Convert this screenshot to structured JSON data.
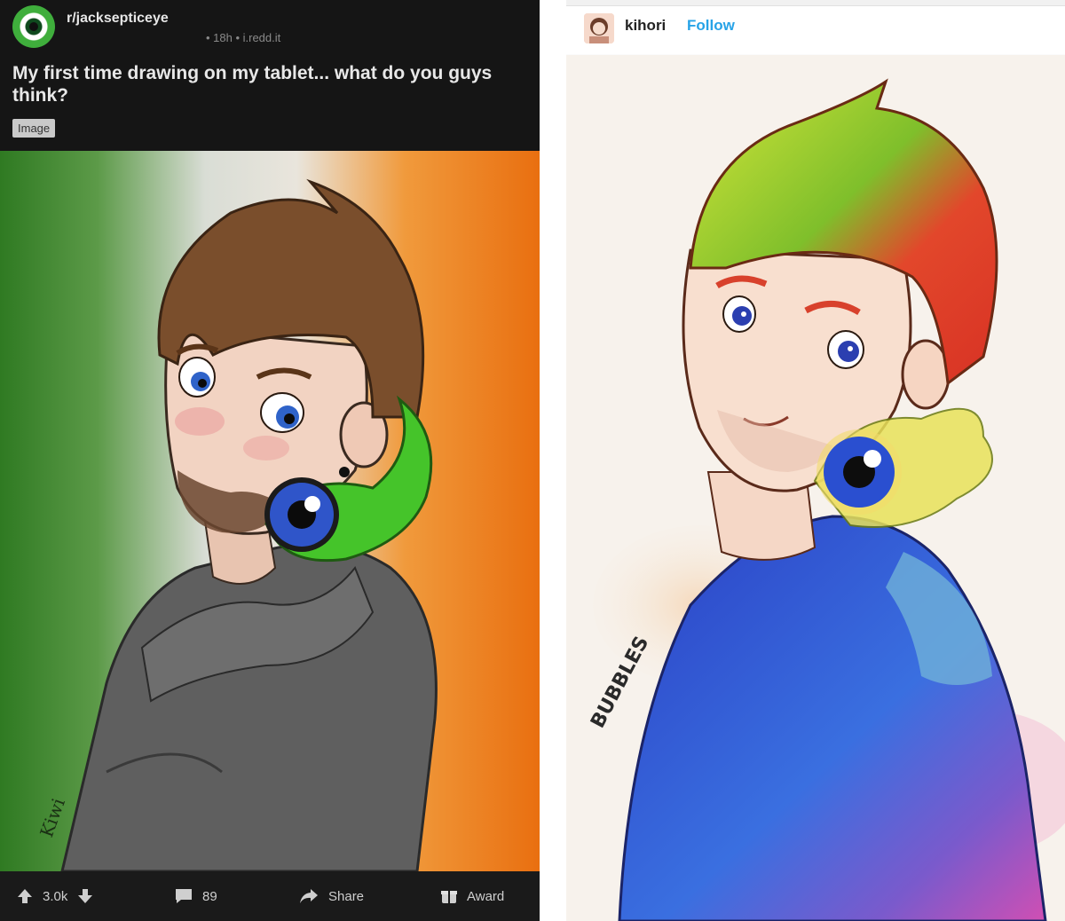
{
  "reddit_post": {
    "subreddit": "r/jacksepticeye",
    "meta": "• 18h • i.redd.it",
    "title": "My first time drawing on my tablet... what do you guys think?",
    "flair": "Image",
    "artwork_signature": "Kiwi",
    "footer": {
      "score": "3.0k",
      "comments": "89",
      "share_label": "Share",
      "award_label": "Award"
    },
    "icons": [
      "upvote-icon",
      "downvote-icon",
      "comment-icon",
      "share-icon",
      "award-icon"
    ]
  },
  "tumblr_post": {
    "username": "kihori",
    "follow_label": "Follow",
    "artwork_signature": "BUBBLES"
  },
  "colors": {
    "reddit_bg": "#141414",
    "flair_bg": "#c9c9c9",
    "follow_blue": "#27a3e7",
    "sam_green": "#3fae3c"
  }
}
